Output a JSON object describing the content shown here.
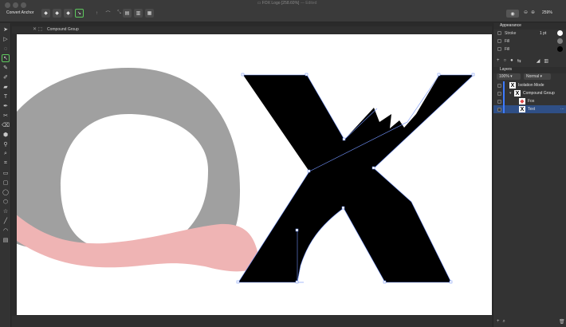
{
  "window": {
    "title": "FOX Logo [258.60%]",
    "subtitle": "— Edited",
    "traffic_colors": [
      "#5a5a5a",
      "#5a5a5a",
      "#5a5a5a"
    ]
  },
  "toolbar": {
    "mode_label": "Convert Anchor",
    "node_tools": [
      "sharp",
      "smooth",
      "smart"
    ],
    "zoom_label": "259%"
  },
  "context": {
    "label": "Compound Group"
  },
  "appearance": {
    "header": "Appearance",
    "rows": [
      {
        "label": "Stroke",
        "value": "1 pt",
        "color": "#ffffff"
      },
      {
        "label": "Fill",
        "value": "",
        "color": "#808080"
      },
      {
        "label": "Fill",
        "value": "",
        "color": "#000000"
      }
    ]
  },
  "layers": {
    "header": "Layers",
    "opacity": "100%",
    "blend_mode": "Normal",
    "items": [
      {
        "name": "Isolation Mode",
        "indent": 0
      },
      {
        "name": "Compound Group",
        "indent": 1
      },
      {
        "name": "Fox",
        "indent": 2
      },
      {
        "name": "Text",
        "indent": 2
      }
    ]
  },
  "colors": {
    "accent": "#5ec85e",
    "selection": "#3d7bff",
    "gray_shape": "#a0a0a0",
    "pink_shape": "#efb4b4",
    "x_shape": "#000000"
  }
}
